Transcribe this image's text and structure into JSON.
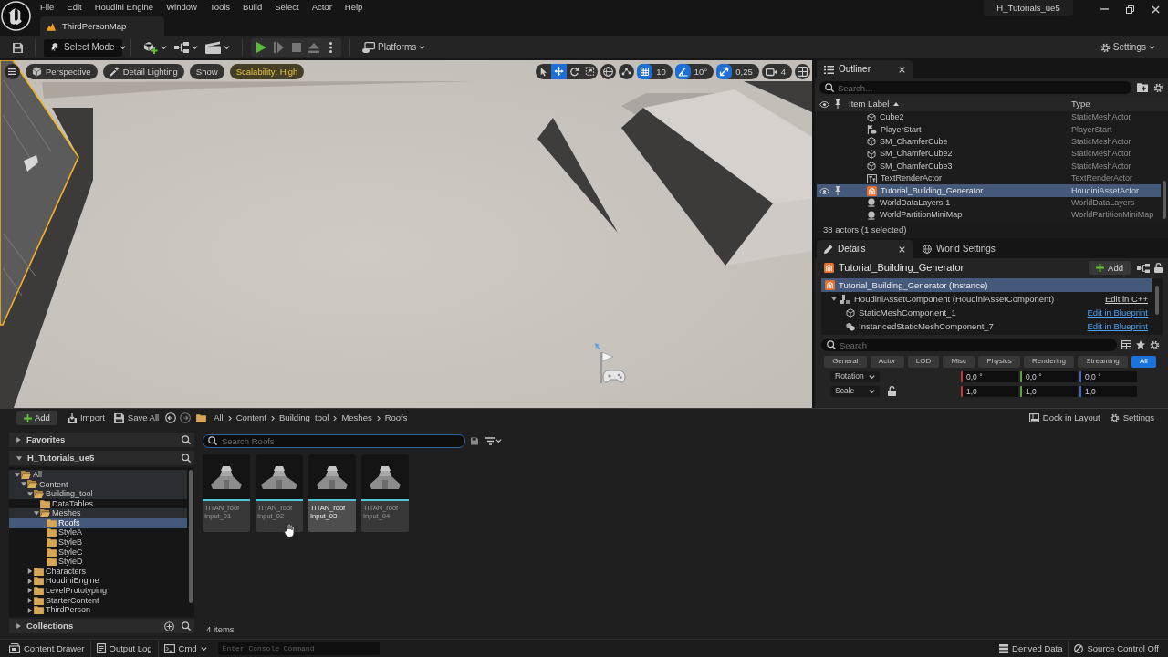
{
  "title_bar": {
    "menu": [
      "File",
      "Edit",
      "Houdini Engine",
      "Window",
      "Tools",
      "Build",
      "Select",
      "Actor",
      "Help"
    ],
    "level_tab": "ThirdPersonMap",
    "project": "H_Tutorials_ue5"
  },
  "toolbar": {
    "mode": "Select Mode",
    "play_controls": [
      {
        "kind": "play",
        "disabled": false
      },
      {
        "kind": "advance",
        "disabled": true
      },
      {
        "kind": "stop",
        "disabled": true
      },
      {
        "kind": "eject",
        "disabled": true
      },
      {
        "kind": "more",
        "disabled": false
      }
    ],
    "platforms": "Platforms",
    "settings": "Settings"
  },
  "viewport": {
    "view_options": [
      {
        "kind": "perspective",
        "label": "Perspective"
      },
      {
        "kind": "lighting",
        "label": "Detail Lighting"
      },
      {
        "kind": "show",
        "label": "Show"
      },
      {
        "kind": "scalability",
        "label": "Scalability: High"
      }
    ],
    "transform_tools": [
      {
        "kind": "select",
        "selected": false
      },
      {
        "kind": "move",
        "selected": true
      },
      {
        "kind": "rotate",
        "selected": false
      },
      {
        "kind": "scale",
        "selected": false
      }
    ],
    "snaps": [
      {
        "kind": "grid",
        "value": "10",
        "on": true
      },
      {
        "kind": "angle",
        "value": "10°",
        "on": true
      },
      {
        "kind": "scale",
        "value": "0,25",
        "on": true
      },
      {
        "kind": "camera_speed",
        "value": "4",
        "on": false
      }
    ]
  },
  "outliner": {
    "title": "Outliner",
    "search_placeholder": "Search...",
    "columns": [
      "Item Label",
      "Type"
    ],
    "rows": [
      {
        "kind": "static_mesh",
        "label": "Cube2",
        "type": "StaticMeshActor",
        "selected": false
      },
      {
        "kind": "player_start",
        "label": "PlayerStart",
        "type": "PlayerStart",
        "selected": false
      },
      {
        "kind": "static_mesh",
        "label": "SM_ChamferCube",
        "type": "StaticMeshActor",
        "selected": false
      },
      {
        "kind": "static_mesh",
        "label": "SM_ChamferCube2",
        "type": "StaticMeshActor",
        "selected": false
      },
      {
        "kind": "static_mesh",
        "label": "SM_ChamferCube3",
        "type": "StaticMeshActor",
        "selected": false
      },
      {
        "kind": "text_render",
        "label": "TextRenderActor",
        "type": "TextRenderActor",
        "selected": false
      },
      {
        "kind": "houdini",
        "label": "Tutorial_Building_Generator",
        "type": "HoudiniAssetActor",
        "selected": true
      },
      {
        "kind": "world",
        "label": "WorldDataLayers-1",
        "type": "WorldDataLayers",
        "selected": false
      },
      {
        "kind": "world",
        "label": "WorldPartitionMiniMap",
        "type": "WorldPartitionMiniMap",
        "selected": false
      }
    ],
    "footer": "38 actors (1 selected)"
  },
  "details": {
    "tabs": [
      {
        "kind": "details",
        "label": "Details",
        "selected": true
      },
      {
        "kind": "world_settings",
        "label": "World Settings",
        "selected": false
      }
    ],
    "actor": "Tutorial_Building_Generator",
    "add_button": "Add",
    "components": [
      {
        "kind": "houdini",
        "label": "Tutorial_Building_Generator (Instance)",
        "selected": true,
        "children": [
          {
            "kind": "houdini_component",
            "label": "HoudiniAssetComponent (HoudiniAssetComponent)",
            "selected": false,
            "expanded": true,
            "action": {
              "kind": "native",
              "label": "Edit in C++"
            },
            "children": [
              {
                "kind": "static_mesh",
                "label": "StaticMeshComponent_1",
                "selected": false,
                "action": {
                  "kind": "blueprint",
                  "label": "Edit in Blueprint"
                }
              },
              {
                "kind": "instanced_mesh",
                "label": "InstancedStaticMeshComponent_7",
                "selected": false,
                "action": {
                  "kind": "blueprint",
                  "label": "Edit in Blueprint"
                }
              }
            ]
          }
        ]
      }
    ],
    "search_placeholder": "Search",
    "filters": [
      {
        "label": "General",
        "selected": false
      },
      {
        "label": "Actor",
        "selected": false
      },
      {
        "label": "LOD",
        "selected": false
      },
      {
        "label": "Misc",
        "selected": false
      },
      {
        "label": "Physics",
        "selected": false
      },
      {
        "label": "Rendering",
        "selected": false
      },
      {
        "label": "Streaming",
        "selected": false
      },
      {
        "label": "All",
        "selected": true
      }
    ],
    "properties": [
      {
        "kind": "rotation",
        "label": "Rotation",
        "values": [
          "0,0 °",
          "0,0 °",
          "0,0 °"
        ]
      },
      {
        "kind": "scale",
        "label": "Scale",
        "values": [
          "1,0",
          "1,0",
          "1,0"
        ]
      }
    ]
  },
  "content_browser": {
    "toolbar": {
      "add": "Add",
      "import": "Import",
      "save_all": "Save All",
      "dock": "Dock in Layout",
      "settings": "Settings"
    },
    "breadcrumbs": [
      "All",
      "Content",
      "Building_tool",
      "Meshes",
      "Roofs"
    ],
    "favorites": {
      "label": "Favorites",
      "expanded": false
    },
    "project": {
      "label": "H_Tutorials_ue5",
      "expanded": true,
      "tree": [
        {
          "label": "All",
          "expanded": true,
          "selected": false,
          "children": [
            {
              "label": "Content",
              "expanded": true,
              "selected": false,
              "children": [
                {
                  "label": "Building_tool",
                  "expanded": true,
                  "selected": false,
                  "children": [
                    {
                      "label": "DataTables",
                      "selected": false
                    },
                    {
                      "label": "Meshes",
                      "expanded": true,
                      "selected": false,
                      "children": [
                        {
                          "label": "Roofs",
                          "selected": true
                        },
                        {
                          "label": "StyleA",
                          "selected": false
                        },
                        {
                          "label": "StyleB",
                          "selected": false
                        },
                        {
                          "label": "StyleC",
                          "selected": false
                        },
                        {
                          "label": "StyleD",
                          "selected": false
                        }
                      ]
                    }
                  ]
                },
                {
                  "label": "Characters",
                  "expanded": false,
                  "selected": false
                },
                {
                  "label": "HoudiniEngine",
                  "expanded": false,
                  "selected": false
                },
                {
                  "label": "LevelPrototyping",
                  "expanded": false,
                  "selected": false
                },
                {
                  "label": "StarterContent",
                  "expanded": false,
                  "selected": false
                },
                {
                  "label": "ThirdPerson",
                  "expanded": false,
                  "selected": false
                }
              ]
            }
          ]
        }
      ]
    },
    "collections": {
      "label": "Collections",
      "expanded": false
    },
    "search_placeholder": "Search Roofs",
    "assets": [
      {
        "lines": [
          "TITAN_roof",
          "Input_01"
        ],
        "hovered": false
      },
      {
        "lines": [
          "TITAN_roof",
          "Input_02"
        ],
        "hovered": false
      },
      {
        "lines": [
          "TITAN_roof",
          "Input_03"
        ],
        "hovered": true
      },
      {
        "lines": [
          "TITAN_roof",
          "Input_04"
        ],
        "hovered": false
      }
    ],
    "count": "4 items"
  },
  "status_bar": {
    "content_drawer": "Content Drawer",
    "output_log": "Output Log",
    "cmd": "Cmd",
    "console_placeholder": "Enter Console Command",
    "derived_data": "Derived Data",
    "source_control": "Source Control Off"
  }
}
